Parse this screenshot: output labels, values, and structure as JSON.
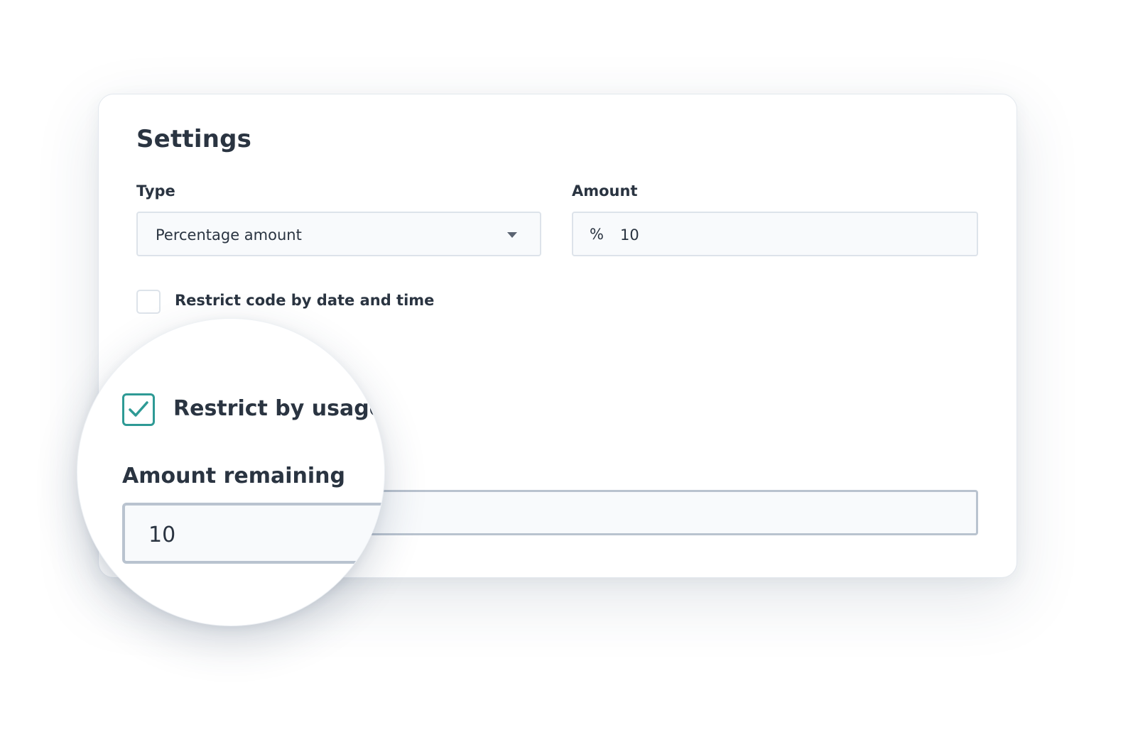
{
  "settings": {
    "title": "Settings",
    "type": {
      "label": "Type",
      "value": "Percentage amount"
    },
    "amount": {
      "label": "Amount",
      "prefix": "%",
      "value": "10"
    },
    "restrict_date": {
      "label": "Restrict code by date and time",
      "checked": false
    },
    "restrict_usage": {
      "label": "Restrict by usage",
      "checked": true
    },
    "amount_remaining": {
      "label": "Amount remaining",
      "value": "10"
    }
  },
  "colors": {
    "accent": "#2e9a95",
    "text": "#2a3441",
    "input_bg": "#f8fafc",
    "input_border": "#dde3ea"
  }
}
